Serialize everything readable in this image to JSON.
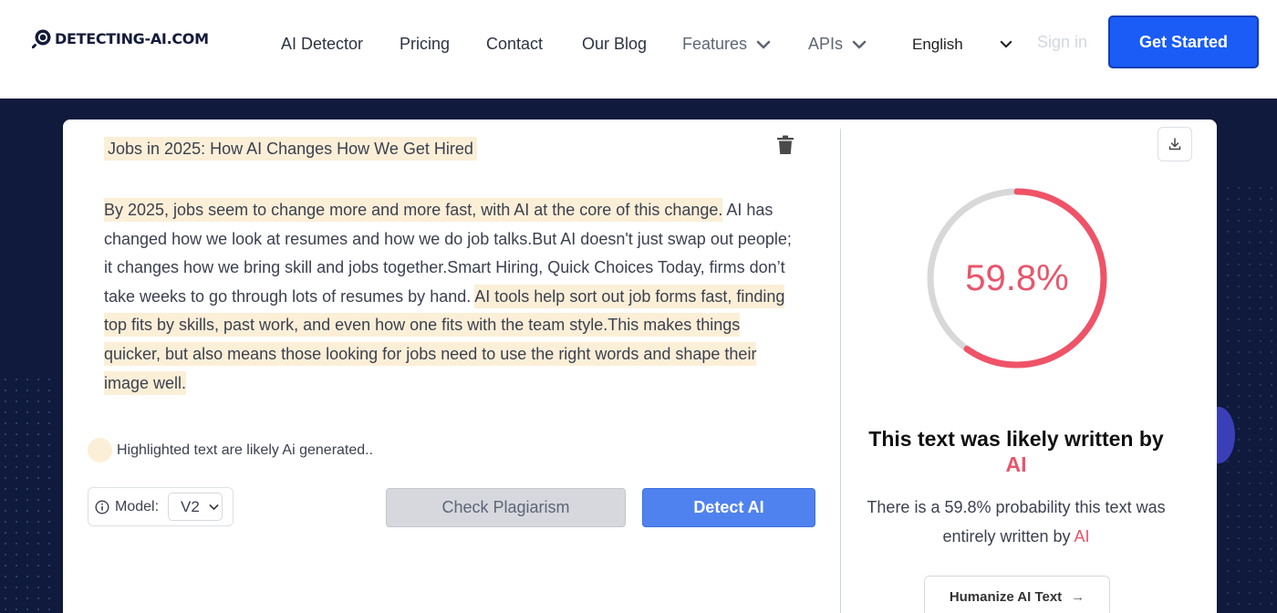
{
  "brand": {
    "name": "DETECTING-AI.COM",
    "logo_icon": "search-magnifier-icon"
  },
  "nav": {
    "items": [
      {
        "label": "AI Detector"
      },
      {
        "label": "Pricing"
      },
      {
        "label": "Contact"
      },
      {
        "label": "Our Blog"
      },
      {
        "label": "Features"
      },
      {
        "label": "APIs"
      }
    ],
    "language": "English",
    "sign_in": "Sign in",
    "cta": "Get Started"
  },
  "editor": {
    "title": "Jobs in 2025: How AI Changes How We Get Hired",
    "paragraph_segments": [
      {
        "text": "By 2025, jobs seem to change more and more fast, with AI at the core of this change.",
        "highlighted": true
      },
      {
        "text": " AI has changed how we look at resumes and how we do job talks.But AI doesn't just swap out people; it changes how we bring skill and jobs together.Smart Hiring, Quick Choices Today, firms don’t take weeks to go through lots of resumes by hand. ",
        "highlighted": false
      },
      {
        "text": "AI tools help sort out job forms fast, finding top fits by skills, past work, and even how one fits with the team style.This makes things quicker, but also means those looking for jobs need to use the right words and shape their image well.",
        "highlighted": true
      }
    ],
    "legend": "Highlighted text are likely Ai generated..",
    "model_label": "Model:",
    "model_value": "V2",
    "check_plagiarism": "Check Plagiarism",
    "detect_ai": "Detect AI"
  },
  "result": {
    "probability_percent": 59.8,
    "probability_label": "59.8%",
    "heading_prefix": "This text was likely written by",
    "heading_ai": "AI",
    "description_prefix": "There is a 59.8% probability this text was entirely written by",
    "description_ai": "AI",
    "humanize_label": "Humanize AI Text",
    "humanize_arrow": "→"
  },
  "colors": {
    "primary": "#1a5cf5",
    "detect_button": "#4f82ee",
    "ai_red": "#e8556b",
    "highlight": "#fbefd7",
    "page_background": "#0f1a3d"
  }
}
